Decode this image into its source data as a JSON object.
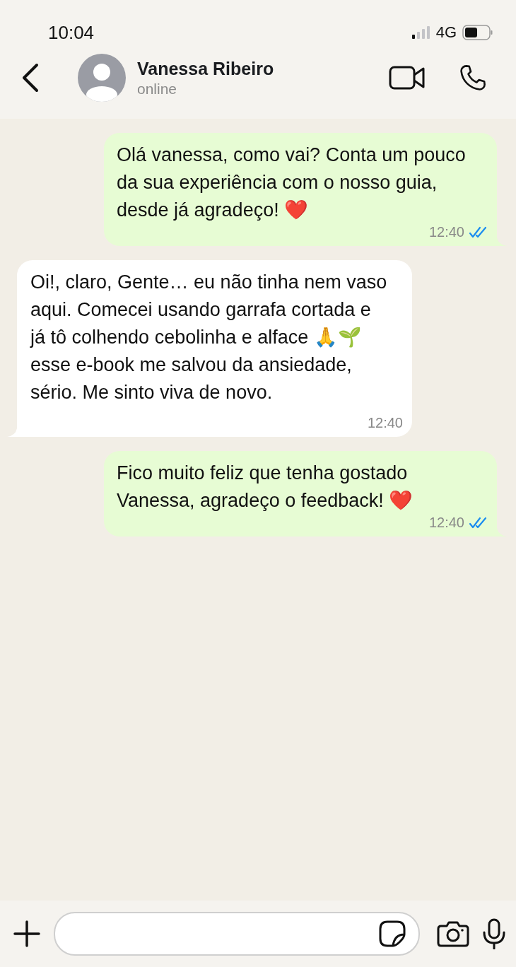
{
  "status_bar": {
    "time": "10:04",
    "network": "4G"
  },
  "header": {
    "name": "Vanessa Ribeiro",
    "status": "online"
  },
  "messages": [
    {
      "kind": "sent",
      "text": "Olá vanessa, como vai? Conta um pouco da sua experiência com o nosso guia, desde já agradeço! ❤️",
      "time": "12:40",
      "read": true
    },
    {
      "kind": "received",
      "text": "Oi!, claro, Gente… eu não tinha nem vaso aqui. Comecei usando garrafa cortada e já tô colhendo cebolinha e alface 🙏🌱 esse e-book me salvou da ansiedade, sério. Me sinto viva de novo.",
      "time": "12:40"
    },
    {
      "kind": "sent",
      "text": "Fico muito feliz que tenha gostado Vanessa, agradeço o feedback! ❤️",
      "time": "12:40",
      "read": true
    }
  ]
}
